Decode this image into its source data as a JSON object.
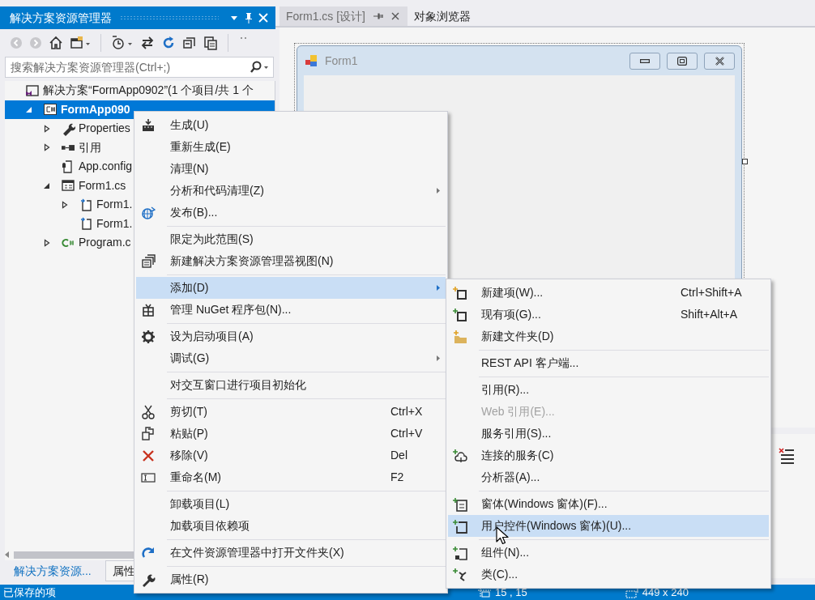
{
  "solution_explorer": {
    "title": "解决方案资源管理器",
    "search": {
      "placeholder": "搜索解决方案资源管理器(Ctrl+;)"
    },
    "tree": [
      {
        "label": "解决方案“FormApp0902”(1 个项目/共 1 个",
        "kind": "solution",
        "selected": false,
        "children": [
          {
            "label": "FormApp090",
            "kind": "project",
            "selected": true,
            "expanded": true,
            "children": [
              {
                "label": "Properties",
                "kind": "properties",
                "selected": false,
                "expanded": false
              },
              {
                "label": "引用",
                "kind": "references",
                "selected": false,
                "expanded": false
              },
              {
                "label": "App.config",
                "kind": "config",
                "selected": false
              },
              {
                "label": "Form1.cs",
                "kind": "form",
                "selected": false,
                "expanded": true,
                "children": [
                  {
                    "label": "Form1.",
                    "kind": "file",
                    "selected": false,
                    "expanded": false
                  },
                  {
                    "label": "Form1.",
                    "kind": "file",
                    "selected": false
                  }
                ]
              },
              {
                "label": "Program.c",
                "kind": "csharp",
                "selected": false,
                "expanded": false
              }
            ]
          }
        ]
      }
    ],
    "tabs": [
      {
        "label": "解决方案资源...",
        "selected": true
      },
      {
        "label": "属性",
        "selected": false
      }
    ]
  },
  "document_tabs": [
    {
      "label": "Form1.cs [设计]",
      "selected": true
    },
    {
      "label": "对象浏览器",
      "selected": false
    }
  ],
  "designer": {
    "form_title": "Form1"
  },
  "context_menu": [
    {
      "kind": "item",
      "label": "生成(U)",
      "selected": false,
      "submenu": false
    },
    {
      "kind": "item",
      "label": "重新生成(E)",
      "selected": false,
      "submenu": false
    },
    {
      "kind": "item",
      "label": "清理(N)",
      "selected": false,
      "submenu": false
    },
    {
      "kind": "item",
      "label": "分析和代码清理(Z)",
      "selected": false,
      "submenu": true
    },
    {
      "kind": "item",
      "label": "发布(B)...",
      "selected": false,
      "submenu": false
    },
    {
      "kind": "separator"
    },
    {
      "kind": "item",
      "label": "限定为此范围(S)",
      "selected": false,
      "submenu": false
    },
    {
      "kind": "item",
      "label": "新建解决方案资源管理器视图(N)",
      "selected": false,
      "submenu": false
    },
    {
      "kind": "separator"
    },
    {
      "kind": "item",
      "label": "添加(D)",
      "selected": true,
      "submenu": true
    },
    {
      "kind": "item",
      "label": "管理 NuGet 程序包(N)...",
      "selected": false,
      "submenu": false
    },
    {
      "kind": "separator"
    },
    {
      "kind": "item",
      "label": "设为启动项目(A)",
      "selected": false,
      "submenu": false
    },
    {
      "kind": "item",
      "label": "调试(G)",
      "selected": false,
      "submenu": true
    },
    {
      "kind": "separator"
    },
    {
      "kind": "item",
      "label": "对交互窗口进行项目初始化",
      "selected": false,
      "submenu": false
    },
    {
      "kind": "separator"
    },
    {
      "kind": "item",
      "label": "剪切(T)",
      "shortcut": "Ctrl+X",
      "selected": false,
      "submenu": false
    },
    {
      "kind": "item",
      "label": "粘贴(P)",
      "shortcut": "Ctrl+V",
      "selected": false,
      "submenu": false
    },
    {
      "kind": "item",
      "label": "移除(V)",
      "shortcut": "Del",
      "selected": false,
      "submenu": false
    },
    {
      "kind": "item",
      "label": "重命名(M)",
      "shortcut": "F2",
      "selected": false,
      "submenu": false
    },
    {
      "kind": "separator"
    },
    {
      "kind": "item",
      "label": "卸载项目(L)",
      "selected": false,
      "submenu": false
    },
    {
      "kind": "item",
      "label": "加载项目依赖项",
      "selected": false,
      "submenu": false
    },
    {
      "kind": "separator"
    },
    {
      "kind": "item",
      "label": "在文件资源管理器中打开文件夹(X)",
      "selected": false,
      "submenu": false
    },
    {
      "kind": "separator"
    },
    {
      "kind": "item",
      "label": "属性(R)",
      "selected": false,
      "submenu": false
    }
  ],
  "add_submenu": [
    {
      "kind": "item",
      "label": "新建项(W)...",
      "shortcut": "Ctrl+Shift+A",
      "selected": false,
      "disabled": false
    },
    {
      "kind": "item",
      "label": "现有项(G)...",
      "shortcut": "Shift+Alt+A",
      "selected": false,
      "disabled": false
    },
    {
      "kind": "item",
      "label": "新建文件夹(D)",
      "selected": false,
      "disabled": false
    },
    {
      "kind": "separator"
    },
    {
      "kind": "item",
      "label": "REST API 客户端...",
      "selected": false,
      "disabled": false
    },
    {
      "kind": "separator"
    },
    {
      "kind": "item",
      "label": "引用(R)...",
      "selected": false,
      "disabled": false
    },
    {
      "kind": "item",
      "label": "Web 引用(E)...",
      "selected": false,
      "disabled": true
    },
    {
      "kind": "item",
      "label": "服务引用(S)...",
      "selected": false,
      "disabled": false
    },
    {
      "kind": "item",
      "label": "连接的服务(C)",
      "selected": false,
      "disabled": false
    },
    {
      "kind": "item",
      "label": "分析器(A)...",
      "selected": false,
      "disabled": false
    },
    {
      "kind": "separator"
    },
    {
      "kind": "item",
      "label": "窗体(Windows 窗体)(F)...",
      "selected": false,
      "disabled": false
    },
    {
      "kind": "item",
      "label": "用户控件(Windows 窗体)(U)...",
      "selected": true,
      "disabled": false
    },
    {
      "kind": "separator"
    },
    {
      "kind": "item",
      "label": "组件(N)...",
      "selected": false,
      "disabled": false
    },
    {
      "kind": "item",
      "label": "类(C)...",
      "selected": false,
      "disabled": false
    }
  ],
  "status_bar": {
    "message": "已保存的项",
    "position": "15 , 15",
    "size": "449 x 240"
  }
}
